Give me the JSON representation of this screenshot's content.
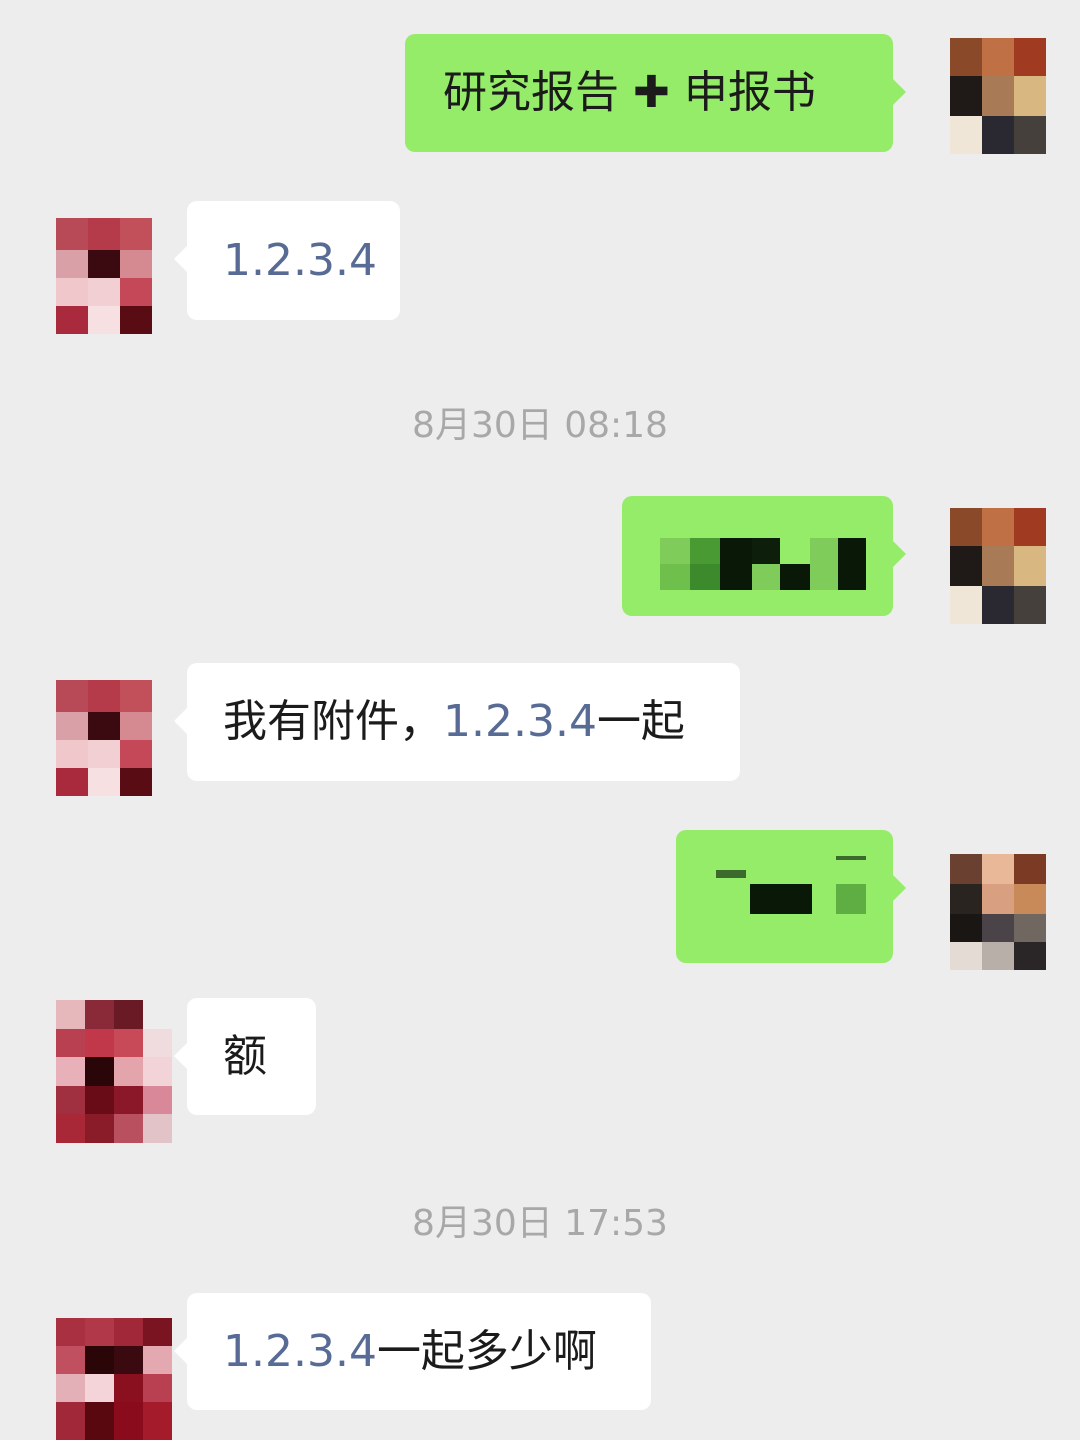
{
  "conversation": {
    "messages": [
      {
        "id": "m1",
        "side": "outgoing",
        "text": "研究报告 ✚ 申报书"
      },
      {
        "id": "m2",
        "side": "incoming",
        "link": "1.2.3.4"
      },
      {
        "id": "m3",
        "side": "outgoing",
        "text": ""
      },
      {
        "id": "m4",
        "side": "incoming",
        "text_prefix": "我有附件，",
        "link": "1.2.3.4",
        "text_suffix": "一起"
      },
      {
        "id": "m5",
        "side": "outgoing",
        "text": ""
      },
      {
        "id": "m6",
        "side": "incoming",
        "text": "额"
      },
      {
        "id": "m7",
        "side": "incoming",
        "link": "1.2.3.4",
        "text_suffix": "一起多少啊"
      }
    ],
    "timestamps": [
      {
        "id": "t1",
        "text": "8月30日 08:18"
      },
      {
        "id": "t2",
        "text": "8月30日 17:53"
      }
    ]
  },
  "colors": {
    "background": "#ededed",
    "outgoing_bubble": "#95ec69",
    "incoming_bubble": "#ffffff",
    "link": "#576b95",
    "timestamp": "#a8a8a8"
  }
}
